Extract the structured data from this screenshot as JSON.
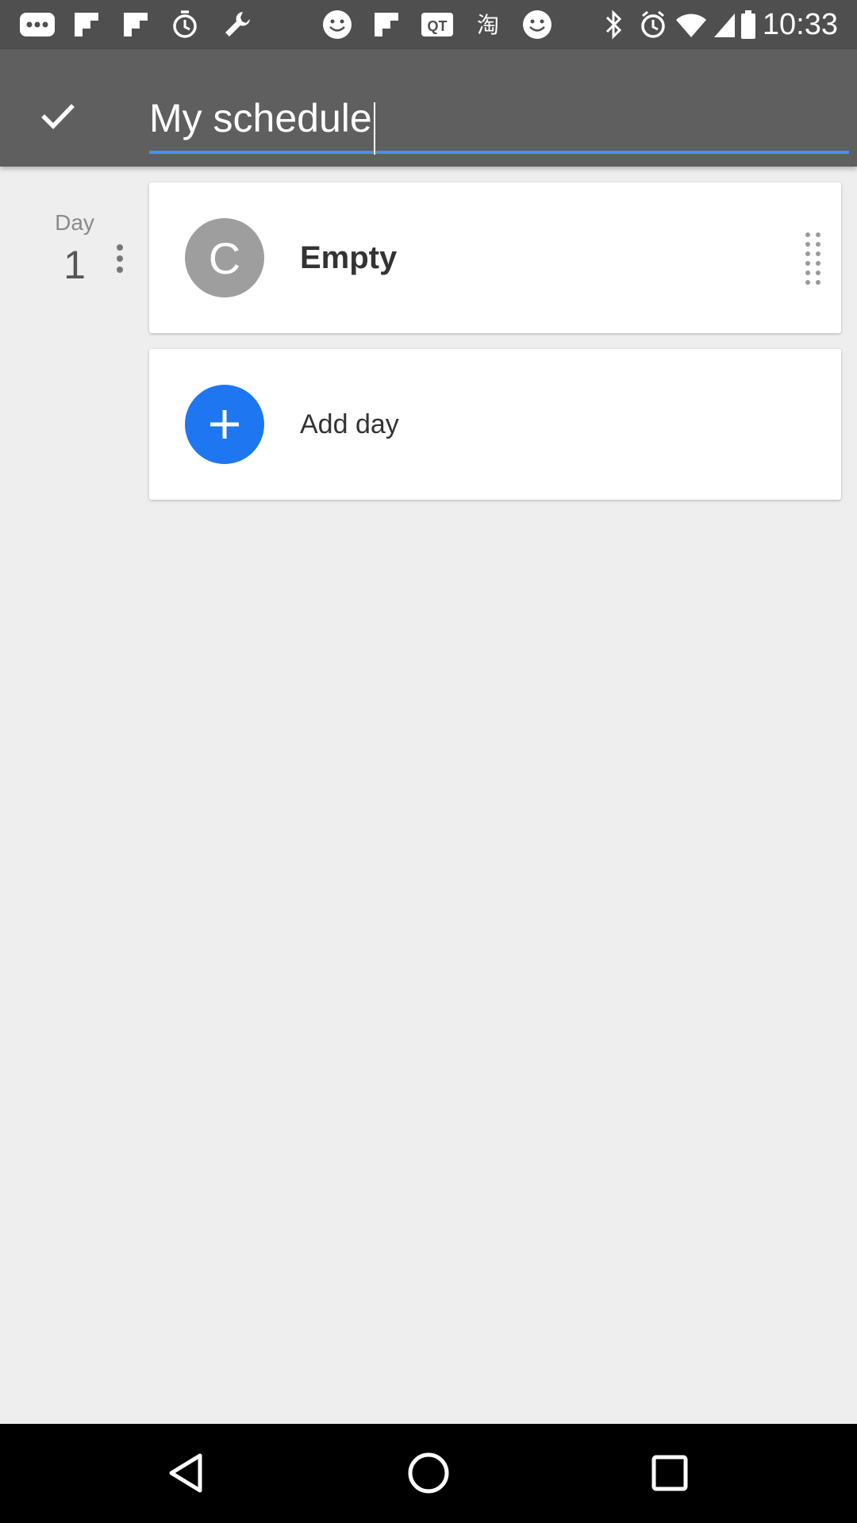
{
  "status_bar": {
    "time": "10:33",
    "icons": [
      "more-horiz-icon",
      "flipboard-icon",
      "flipboard-icon",
      "alarm-icon",
      "wrench-icon",
      "smiley-icon",
      "flipboard-icon",
      "qt-icon",
      "taobao-icon",
      "smiley-icon",
      "bluetooth-icon",
      "alarm-icon",
      "wifi-icon",
      "signal-icon",
      "battery-icon"
    ]
  },
  "app_bar": {
    "confirm_icon": "check-icon",
    "title_value": "My schedule",
    "accent_color": "#4a8ef5"
  },
  "day": {
    "label": "Day",
    "number": "1",
    "menu_icon": "more-vert-icon"
  },
  "cards": {
    "empty": {
      "avatar_letter": "C",
      "label": "Empty",
      "handle_icon": "drag-handle-icon"
    },
    "add": {
      "icon": "plus-icon",
      "label": "Add day",
      "color": "#1e76f0"
    }
  },
  "nav_bar": {
    "back_icon": "back-triangle-icon",
    "home_icon": "home-circle-icon",
    "recents_icon": "recents-square-icon"
  }
}
